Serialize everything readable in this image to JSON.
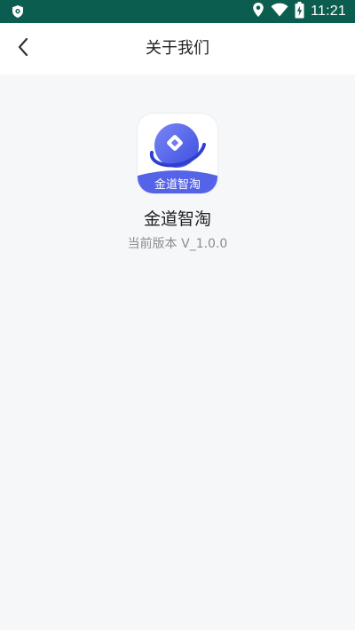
{
  "status_bar": {
    "time": "11:21",
    "icons": [
      "shield-icon",
      "location-icon",
      "wifi-icon",
      "battery-charging-icon"
    ],
    "background": "#0b5e4f"
  },
  "nav": {
    "back_icon": "chevron-left-icon",
    "title": "关于我们"
  },
  "app": {
    "logo_text": "金道智淘",
    "name": "金道智淘",
    "version": "当前版本 V_1.0.0",
    "brand_color": "#5563e8"
  }
}
